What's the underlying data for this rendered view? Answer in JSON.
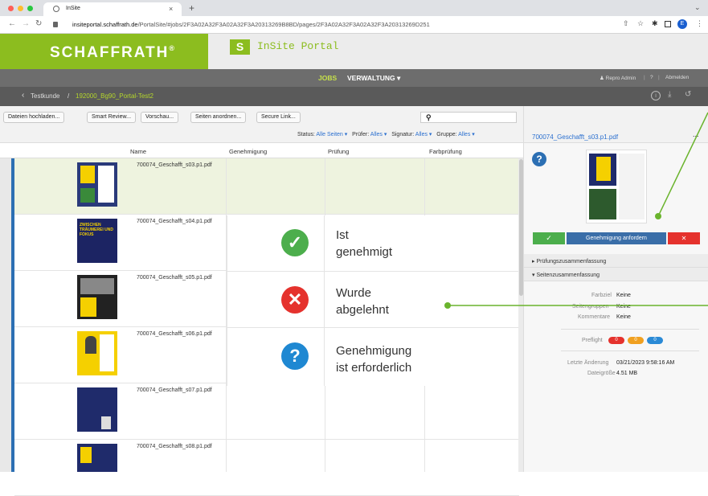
{
  "browser": {
    "tab_title": "InSite",
    "new_tab": "+",
    "url_domain": "insiteportal.schaffrath.de",
    "url_path": "/PortalSite/#jobs/2F3A02A32F3A02A32F3A20313269B8BD/pages/2F3A02A32F3A02A32F3A20313269D251"
  },
  "brand": {
    "company": "SCHAFFRATH",
    "reg": "®",
    "s_letter": "S",
    "portal": "InSite Portal"
  },
  "nav": {
    "jobs": "JOBS",
    "verwaltung": "VERWALTUNG ▾",
    "user": "Repro Admin",
    "help": "?",
    "logout": "Abmelden",
    "sep": "|"
  },
  "breadcrumb": {
    "back": "‹",
    "root": "Testkunde",
    "sep": "/",
    "job": "192000_Bg90_Portal-Test2"
  },
  "toolbar": {
    "upload": "Dateien hochladen...",
    "smart": "Smart Review...",
    "preview": "Vorschau...",
    "arrange": "Seiten anordnen...",
    "secure": "Secure Link..."
  },
  "filters": {
    "status_label": "Status:",
    "status_value": "Alle Seiten ▾",
    "pruefer_label": "Prüfer:",
    "pruefer_value": "Alles ▾",
    "signatur_label": "Signatur:",
    "signatur_value": "Alles ▾",
    "gruppe_label": "Gruppe:",
    "gruppe_value": "Alles ▾"
  },
  "columns": {
    "name": "Name",
    "approval": "Genehmigung",
    "check": "Prüfung",
    "color": "Farbprüfung"
  },
  "rows": [
    {
      "name": "700074_Geschafft_s03.p1.pdf"
    },
    {
      "name": "700074_Geschafft_s04.p1.pdf"
    },
    {
      "name": "700074_Geschafft_s05.p1.pdf"
    },
    {
      "name": "700074_Geschafft_s06.p1.pdf"
    },
    {
      "name": "700074_Geschafft_s07.p1.pdf"
    },
    {
      "name": "700074_Geschafft_s08.p1.pdf"
    }
  ],
  "thumb_text": "ZWISCHEN TRÄUMEREI UND FOKUS",
  "legend": {
    "approved_line1": "Ist",
    "approved_line2": "genehmigt",
    "rejected_line1": "Wurde",
    "rejected_line2": "abgelehnt",
    "required_line1": "Genehmigung",
    "required_line2": "ist erforderlich"
  },
  "panel": {
    "filename": "700074_Geschafft_s03.p1.pdf",
    "more": "...",
    "help": "?",
    "approve_check": "✓",
    "request": "Genehmigung anfordern",
    "reject_x": "✕",
    "sec_pruefung": "Prüfungszusammenfassung",
    "sec_seiten": "Seitenzusammenfassung",
    "farbziel_label": "Farbziel",
    "farbziel_value": "Keine",
    "seitengruppen_label": "Seitengruppen",
    "seitengruppen_value": "Keine",
    "kommentare_label": "Kommentare",
    "kommentare_value": "Keine",
    "preflight_label": "Preflight",
    "pf1": "0",
    "pf2": "0",
    "pf3": "0",
    "letzte_label": "Letzte Änderung",
    "letzte_value": "03/21/2023 9:58:16 AM",
    "size_label": "Dateigröße",
    "size_value": "4.51 MB"
  },
  "colors": {
    "brand_green": "#8cbd1f",
    "approve_green": "#4cae4c",
    "reject_red": "#e5322d",
    "request_blue": "#3a6ea8",
    "help_blue": "#1f88d2",
    "annotation_green": "#6ab42d"
  }
}
